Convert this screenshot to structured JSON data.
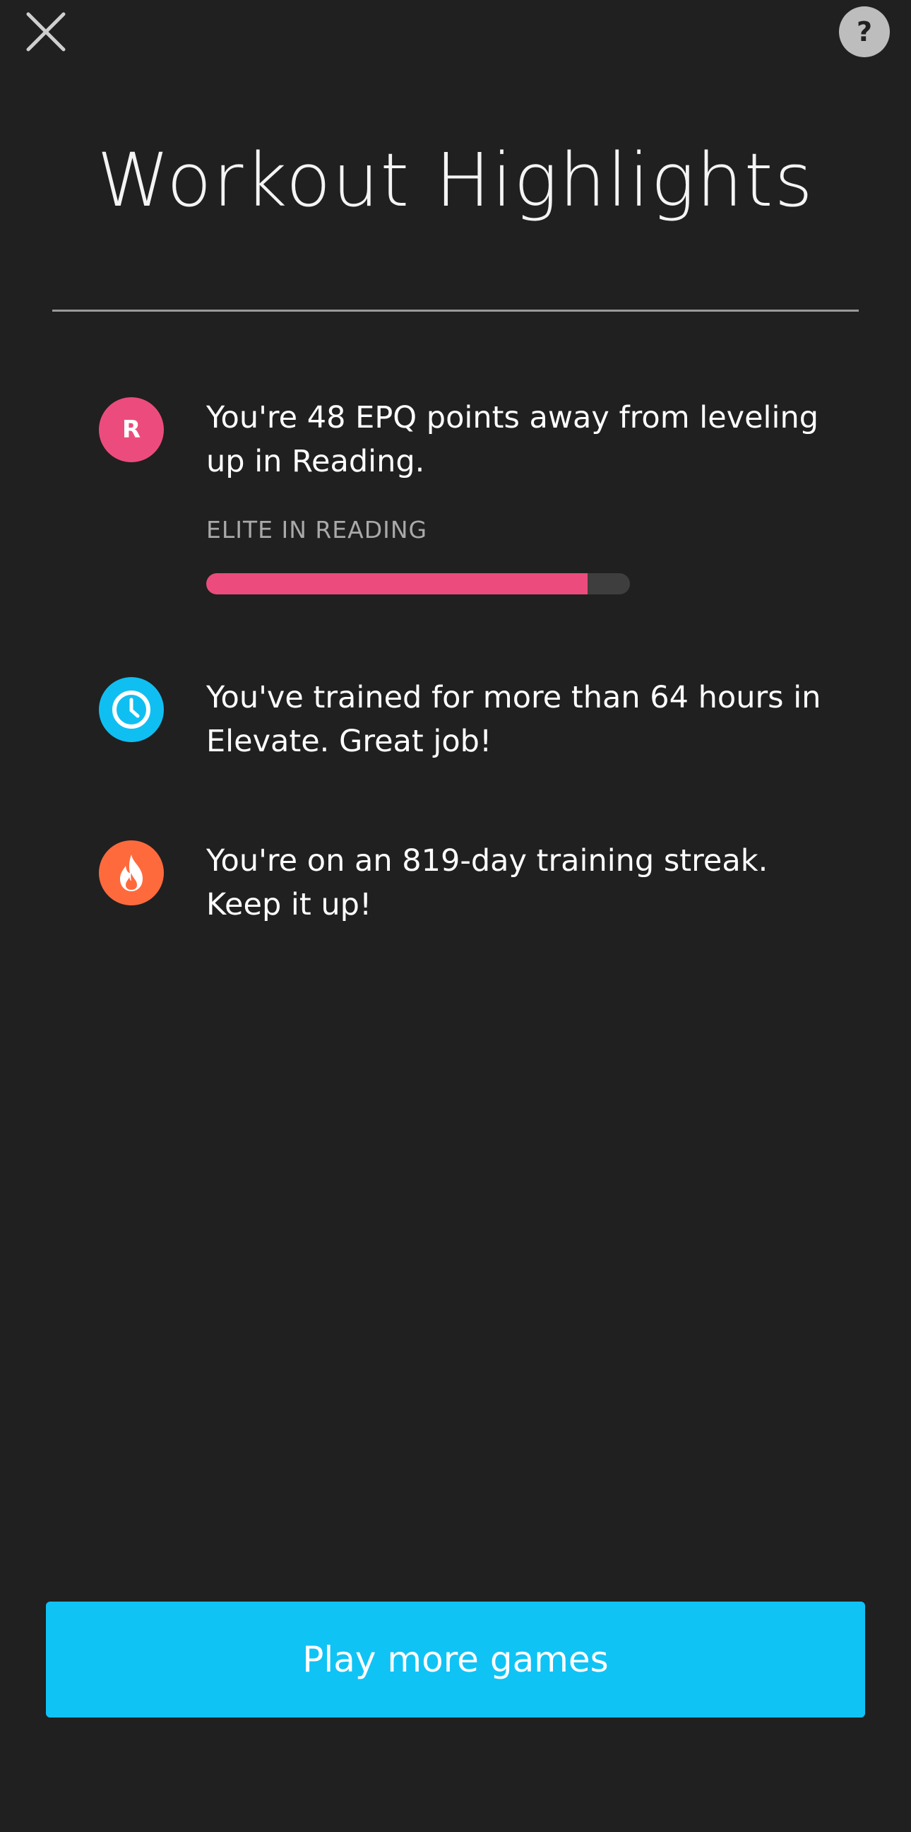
{
  "header": {
    "close_icon": "close-icon",
    "help_label": "?"
  },
  "title": "Workout Highlights",
  "highlights": [
    {
      "icon": "reading-badge-icon",
      "icon_letter": "R",
      "text": "You're 48 EPQ points away from leveling up in Reading.",
      "level_label": "ELITE IN READING",
      "progress": 0.9
    },
    {
      "icon": "clock-icon",
      "text": "You've trained for more than 64 hours in Elevate. Great job!"
    },
    {
      "icon": "flame-icon",
      "text": "You're on an 819-day training streak. Keep it up!"
    }
  ],
  "cta": {
    "label": "Play more games"
  },
  "colors": {
    "background": "#202020",
    "reading": "#ec4c7d",
    "clock": "#10bff1",
    "flame": "#ff6a3d",
    "cta": "#10c3f5"
  }
}
